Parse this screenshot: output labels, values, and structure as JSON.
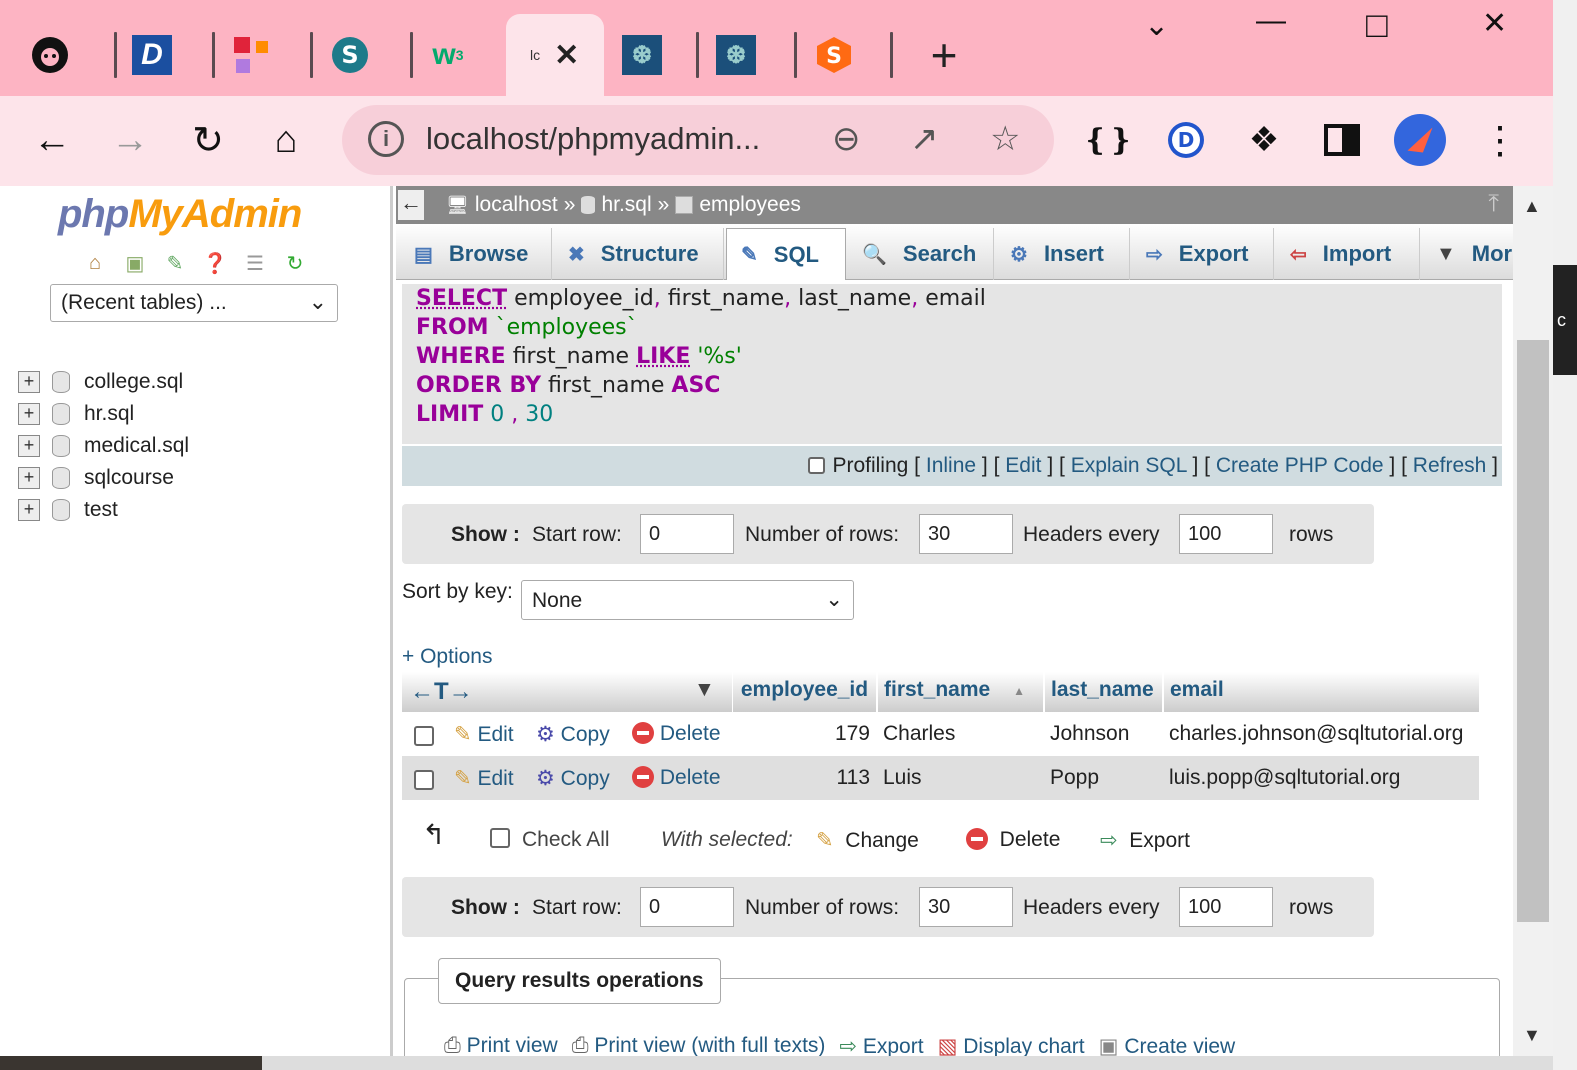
{
  "browser": {
    "tabs": [
      {
        "icon": "github-icon",
        "glyph": "●",
        "color": "#111111"
      },
      {
        "icon": "d-app-icon",
        "glyph": "D",
        "color": "#1b4fa0"
      },
      {
        "icon": "figma-like-icon",
        "glyph": "■",
        "color": "#e0233a"
      },
      {
        "icon": "sync-icon",
        "glyph": "S",
        "color": "#1e7a8a"
      },
      {
        "icon": "w3schools-icon",
        "glyph": "w³",
        "color": "#04aa6d"
      },
      {
        "icon": "active-tab-icon",
        "title": "lc",
        "close": "✕"
      },
      {
        "icon": "mysql-icon",
        "glyph": "❆",
        "color": "#1b4f7a"
      },
      {
        "icon": "mysql-icon",
        "glyph": "❆",
        "color": "#1b4f7a"
      },
      {
        "icon": "sublime-icon",
        "glyph": "S",
        "color": "#ff6a13"
      }
    ],
    "new_tab": "+",
    "url": "localhost/phpmyadmin...",
    "window_controls": {
      "dropdown": "⌵",
      "minimize": "—",
      "maximize": "□",
      "close": "✕"
    }
  },
  "sidebar": {
    "logo_php": "php",
    "logo_myadmin": "MyAdmin",
    "recent_tables": "(Recent tables) ...",
    "databases": [
      "college.sql",
      "hr.sql",
      "medical.sql",
      "sqlcourse",
      "test"
    ]
  },
  "breadcrumb": {
    "server": "localhost",
    "sep1": "»",
    "database": "hr.sql",
    "sep2": "»",
    "table": "employees"
  },
  "tabs": [
    {
      "label": "Browse",
      "icon": "browse-icon",
      "active": false
    },
    {
      "label": "Structure",
      "icon": "structure-icon",
      "active": false
    },
    {
      "label": "SQL",
      "icon": "sql-icon",
      "active": true
    },
    {
      "label": "Search",
      "icon": "search-icon",
      "active": false
    },
    {
      "label": "Insert",
      "icon": "insert-icon",
      "active": false
    },
    {
      "label": "Export",
      "icon": "export-icon",
      "active": false
    },
    {
      "label": "Import",
      "icon": "import-icon",
      "active": false
    },
    {
      "label": "Mor",
      "icon": "more-icon",
      "active": false
    }
  ],
  "sql": {
    "select_kw": "SELECT",
    "select_cols_1": "employee_id",
    "select_cols_2": "first_name",
    "select_cols_3": "last_name",
    "select_cols_4": "email",
    "comma": ",",
    "from_kw": "FROM",
    "from_table": "`employees`",
    "where_kw": "WHERE",
    "where_col": "first_name",
    "like_kw": "LIKE",
    "like_val": "'%s'",
    "order_kw": "ORDER BY",
    "order_col": "first_name",
    "asc_kw": "ASC",
    "limit_kw": "LIMIT",
    "limit_start": "0",
    "limit_count": "30"
  },
  "sql_actions": {
    "profiling": "Profiling",
    "inline": "Inline",
    "edit": "Edit",
    "explain": "Explain SQL",
    "php": "Create PHP Code",
    "refresh": "Refresh",
    "lbr": "[",
    "rbr": "]"
  },
  "show": {
    "label": "Show :",
    "start_row_label": "Start row:",
    "start_row": "0",
    "num_rows_label": "Number of rows:",
    "num_rows": "30",
    "headers_every_label": "Headers every",
    "headers_every": "100",
    "rows_label": "rows"
  },
  "sort": {
    "label": "Sort by key:",
    "value": "None"
  },
  "options_label": "+ Options",
  "grid": {
    "arrows": "←T→",
    "columns": [
      "employee_id",
      "first_name",
      "last_name",
      "email"
    ],
    "sort_indicator": "▲",
    "action_edit": "Edit",
    "action_copy": "Copy",
    "action_delete": "Delete",
    "rows": [
      {
        "employee_id": "179",
        "first_name": "Charles",
        "last_name": "Johnson",
        "email": "charles.johnson@sqltutorial.org"
      },
      {
        "employee_id": "113",
        "first_name": "Luis",
        "last_name": "Popp",
        "email": "luis.popp@sqltutorial.org"
      }
    ]
  },
  "with_selected": {
    "check_all": "Check All",
    "label": "With selected:",
    "change": "Change",
    "delete": "Delete",
    "export": "Export"
  },
  "query_results": {
    "title": "Query results operations",
    "links": [
      "Print view",
      "Print view (with full texts)",
      "Export",
      "Display chart",
      "Create view"
    ]
  },
  "colors": {
    "link": "#235a81",
    "keyword": "#990099",
    "tab_strip": "#fdb4c3"
  }
}
